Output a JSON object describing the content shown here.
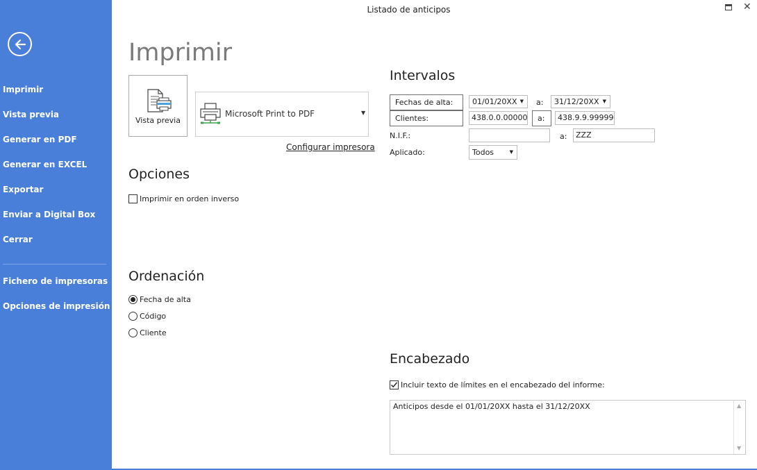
{
  "window": {
    "title": "Listado de anticipos"
  },
  "sidebar": {
    "items": [
      {
        "label": "Imprimir"
      },
      {
        "label": "Vista previa"
      },
      {
        "label": "Generar en PDF"
      },
      {
        "label": "Generar en EXCEL"
      },
      {
        "label": "Exportar"
      },
      {
        "label": "Enviar a Digital Box"
      },
      {
        "label": "Cerrar"
      }
    ],
    "extra": [
      {
        "label": "Fichero de impresoras"
      },
      {
        "label": "Opciones de impresión"
      }
    ]
  },
  "print": {
    "heading": "Imprimir",
    "preview_label": "Vista previa",
    "printer_name": "Microsoft Print to PDF",
    "config_link": "Configurar impresora"
  },
  "options": {
    "heading": "Opciones",
    "reverse_label": "Imprimir en orden inverso",
    "reverse_checked": false
  },
  "ordering": {
    "heading": "Ordenación",
    "items": [
      {
        "label": "Fecha de alta",
        "selected": true
      },
      {
        "label": "Código",
        "selected": false
      },
      {
        "label": "Cliente",
        "selected": false
      }
    ]
  },
  "intervals": {
    "heading": "Intervalos",
    "fechas_label": "Fechas de alta:",
    "fecha_desde": "01/01/20XX",
    "fecha_a_label": "a:",
    "fecha_hasta": "31/12/20XX",
    "clientes_label": "Clientes:",
    "cliente_desde": "438.0.0.00000",
    "cliente_a_label": "a:",
    "cliente_hasta": "438.9.9.99999",
    "nif_label": "N.I.F.:",
    "nif_desde": "",
    "nif_a_label": "a:",
    "nif_hasta": "ZZZ",
    "aplicado_label": "Aplicado:",
    "aplicado_value": "Todos"
  },
  "header": {
    "heading": "Encabezado",
    "include_label": "Incluir texto de límites en el encabezado del informe:",
    "include_checked": true,
    "text": "Anticipos desde el 01/01/20XX hasta el 31/12/20XX"
  },
  "colors": {
    "sidebar": "#4a7fd9"
  }
}
